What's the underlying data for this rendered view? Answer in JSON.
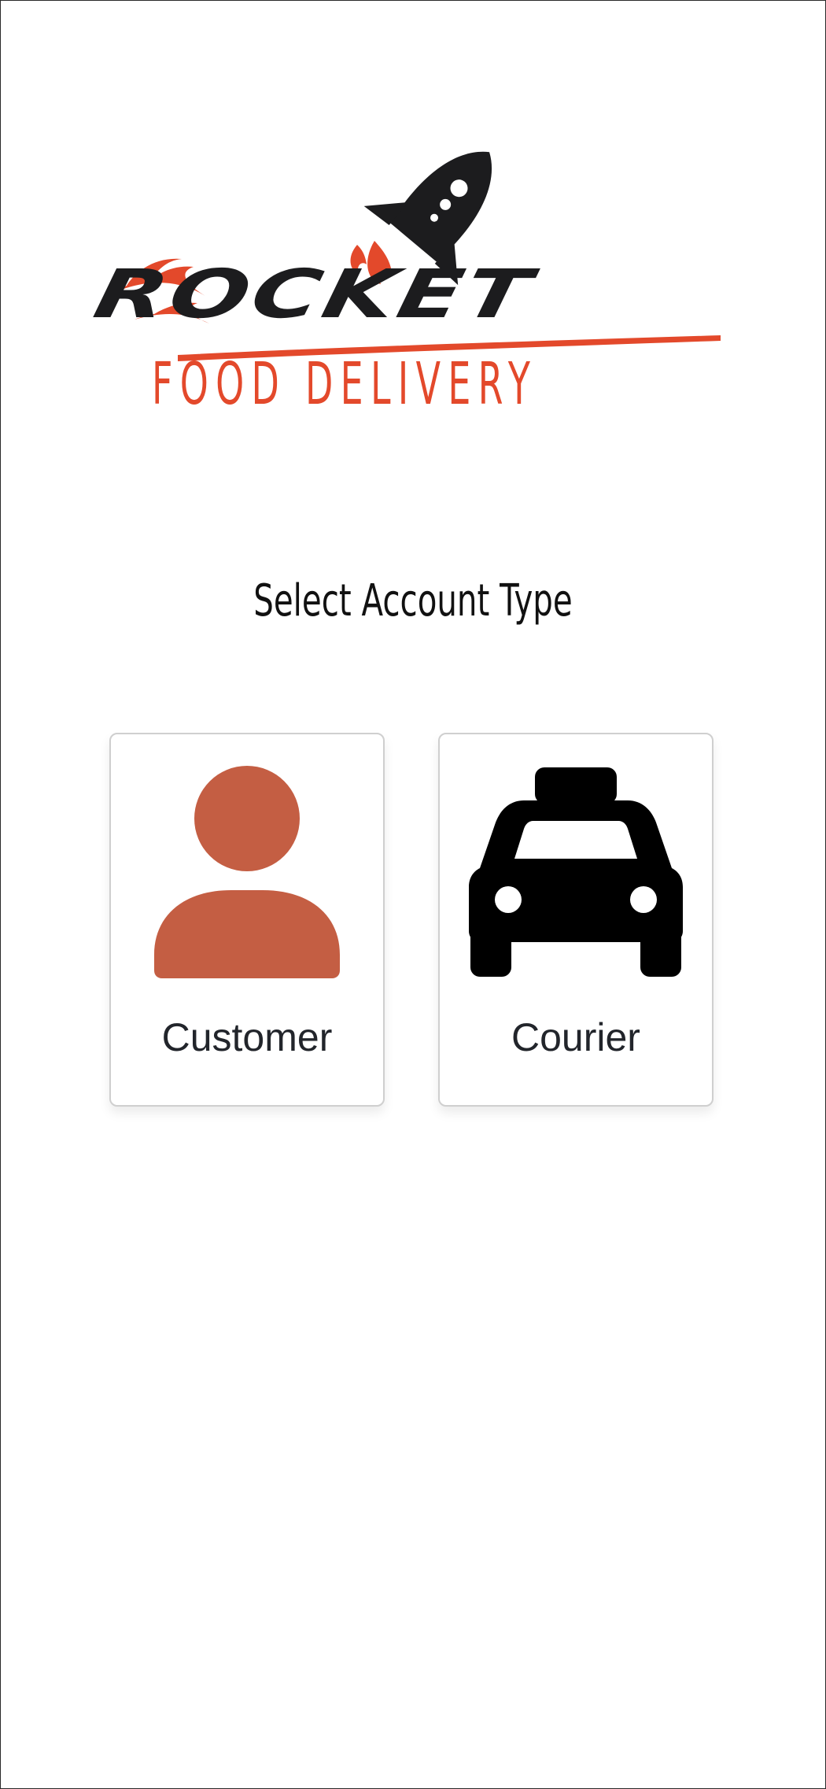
{
  "logo": {
    "word": "ROCKET",
    "tagline": "FOOD DELIVERY",
    "colors": {
      "dark": "#1c1c1e",
      "flame": "#e3492b"
    }
  },
  "heading": "Select Account Type",
  "account_types": [
    {
      "label": "Customer",
      "icon": "person-icon",
      "icon_color": "#c45e43"
    },
    {
      "label": "Courier",
      "icon": "taxi-icon",
      "icon_color": "#000000"
    }
  ]
}
